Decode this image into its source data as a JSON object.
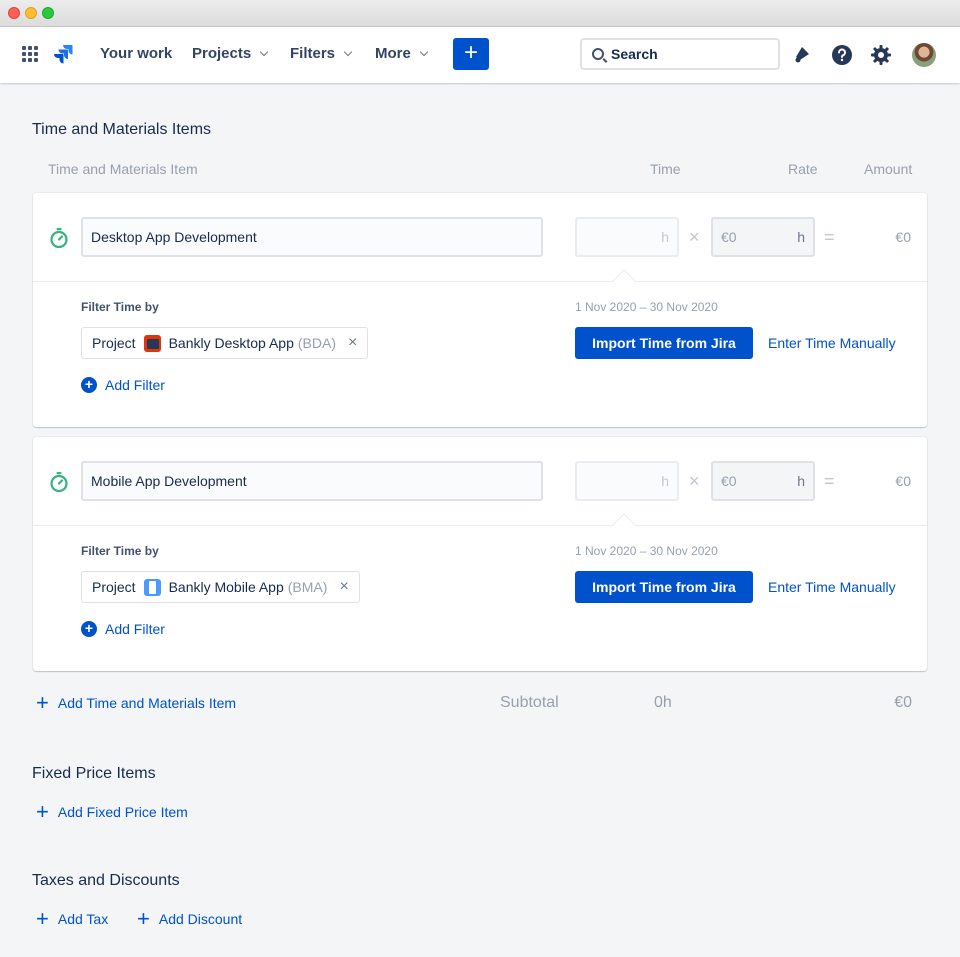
{
  "nav": {
    "your_work": "Your work",
    "projects": "Projects",
    "filters": "Filters",
    "more": "More",
    "create": "+",
    "search_placeholder": "Search"
  },
  "tm_section": {
    "title": "Time and Materials Items",
    "columns": {
      "item": "Time and Materials Item",
      "time": "Time",
      "rate": "Rate",
      "amount": "Amount"
    },
    "items": [
      {
        "name": "Desktop App Development",
        "hours_unit": "h",
        "rate_value": "€0",
        "rate_unit": "h",
        "multiply": "×",
        "equals": "=",
        "amount": "€0",
        "filter_label": "Filter Time by",
        "filter_field": "Project",
        "filter_value": "Bankly Desktop App",
        "filter_key": "(BDA)",
        "remove": "×",
        "add_filter": "Add Filter",
        "date_range": "1 Nov 2020 – 30 Nov 2020",
        "import_label": "Import Time from Jira",
        "manual_label": "Enter Time Manually"
      },
      {
        "name": "Mobile App Development",
        "hours_unit": "h",
        "rate_value": "€0",
        "rate_unit": "h",
        "multiply": "×",
        "equals": "=",
        "amount": "€0",
        "filter_label": "Filter Time by",
        "filter_field": "Project",
        "filter_value": "Bankly Mobile App",
        "filter_key": "(BMA)",
        "remove": "×",
        "add_filter": "Add Filter",
        "date_range": "1 Nov 2020 – 30 Nov 2020",
        "import_label": "Import Time from Jira",
        "manual_label": "Enter Time Manually"
      }
    ],
    "add_item": "Add Time and Materials Item",
    "subtotal_label": "Subtotal",
    "subtotal_time": "0h",
    "subtotal_amount": "€0"
  },
  "fixed_section": {
    "title": "Fixed Price Items",
    "add_item": "Add Fixed Price Item"
  },
  "taxes_section": {
    "title": "Taxes and Discounts",
    "add_tax": "Add Tax",
    "add_discount": "Add Discount"
  },
  "colors": {
    "primary": "#0052cc",
    "timer_green": "#36b37e",
    "page_bg": "#f4f5f7"
  },
  "icons": [
    "app-switcher-icon",
    "jira-logo-icon",
    "search-icon",
    "notifications-icon",
    "help-icon",
    "settings-icon",
    "timer-icon",
    "add-circle-icon",
    "plus-icon",
    "close-icon"
  ]
}
